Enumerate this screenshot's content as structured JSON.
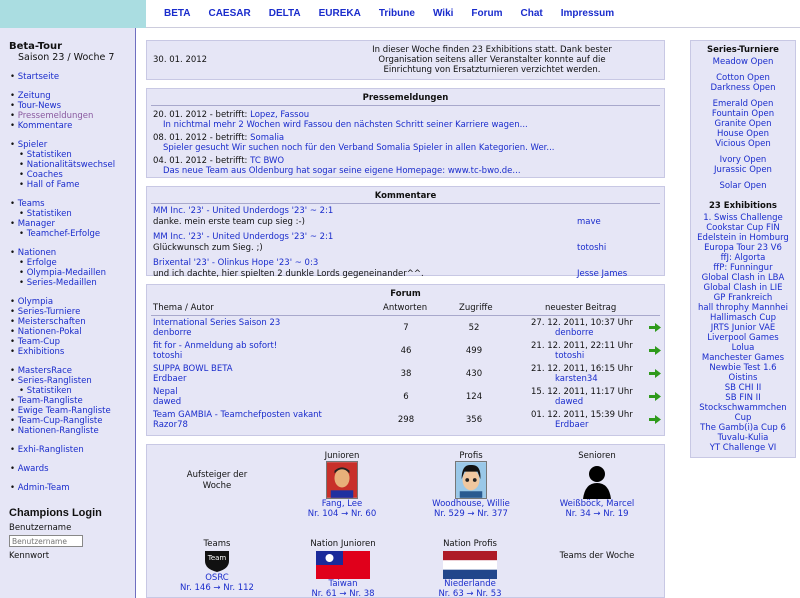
{
  "nav": [
    "BETA",
    "CAESAR",
    "DELTA",
    "EUREKA",
    "Tribune",
    "Wiki",
    "Forum",
    "Chat",
    "Impressum"
  ],
  "sidebar": {
    "title": "Beta-Tour",
    "season": "Saison 23 / Woche 7",
    "groups": [
      [
        {
          "t": "Startseite"
        }
      ],
      [
        {
          "t": "Zeitung"
        },
        {
          "t": "Tour-News"
        },
        {
          "t": "Pressemeldungen",
          "cur": true
        },
        {
          "t": "Kommentare"
        }
      ],
      [
        {
          "t": "Spieler"
        },
        {
          "t": "Statistiken",
          "sub": true
        },
        {
          "t": "Nationalitätswechsel",
          "sub": true
        },
        {
          "t": "Coaches",
          "sub": true
        },
        {
          "t": "Hall of Fame",
          "sub": true
        }
      ],
      [
        {
          "t": "Teams"
        },
        {
          "t": "Statistiken",
          "sub": true
        },
        {
          "t": "Manager"
        },
        {
          "t": "Teamchef-Erfolge",
          "sub": true
        }
      ],
      [
        {
          "t": "Nationen"
        },
        {
          "t": "Erfolge",
          "sub": true
        },
        {
          "t": "Olympia-Medaillen",
          "sub": true
        },
        {
          "t": "Series-Medaillen",
          "sub": true
        }
      ],
      [
        {
          "t": "Olympia"
        },
        {
          "t": "Series-Turniere"
        },
        {
          "t": "Meisterschaften"
        },
        {
          "t": "Nationen-Pokal"
        },
        {
          "t": "Team-Cup"
        },
        {
          "t": "Exhibitions"
        }
      ],
      [
        {
          "t": "MastersRace"
        },
        {
          "t": "Series-Ranglisten"
        },
        {
          "t": "Statistiken",
          "sub": true
        },
        {
          "t": "Team-Rangliste"
        },
        {
          "t": "Ewige Team-Rangliste"
        },
        {
          "t": "Team-Cup-Rangliste"
        },
        {
          "t": "Nationen-Rangliste"
        }
      ],
      [
        {
          "t": "Exhi-Ranglisten"
        }
      ],
      [
        {
          "t": "Awards"
        }
      ],
      [
        {
          "t": "Admin-Team"
        }
      ]
    ]
  },
  "login": {
    "title": "Champions Login",
    "user_label": "Benutzername",
    "user_placeholder": "Benutzername",
    "pass_label": "Kennwort"
  },
  "news": {
    "date": "30. 01. 2012",
    "text": "In dieser Woche finden 23 Exhibitions statt. Dank bester Organisation seitens aller Veranstalter konnte auf die Einrichtung von Ersatzturnieren verzichtet werden."
  },
  "press": {
    "title": "Pressemeldungen",
    "items": [
      {
        "date": "20. 01. 2012",
        "by": " - betrifft: ",
        "who": "Lopez, Fassou",
        "text": "In nichtmal mehr 2 Wochen wird Fassou den nächsten Schritt seiner Karriere wagen..."
      },
      {
        "date": "08. 01. 2012",
        "by": " - betrifft: ",
        "who": "Somalia",
        "text": "Spieler gesucht Wir suchen noch für den Verband Somalia Spieler in allen Kategorien. Wer..."
      },
      {
        "date": "04. 01. 2012",
        "by": " - betrifft: ",
        "who": "TC BWO",
        "text": "Das neue Team aus Oldenburg hat sogar seine eigene Homepage: www.tc-bwo.de..."
      }
    ]
  },
  "comments": {
    "title": "Kommentare",
    "items": [
      {
        "match": "MM Inc. '23' - United Underdogs '23'   ~   2:1",
        "text": "danke. mein erste team cup sieg :-)",
        "author": "mave"
      },
      {
        "match": "MM Inc. '23' - United Underdogs '23'   ~   2:1",
        "text": "Glückwunsch zum Sieg. ;)",
        "author": "totoshi"
      },
      {
        "match": "Brixental '23' - Olinkus Hope '23'   ~   0:3",
        "text": "und ich dachte, hier spielten 2 dunkle Lords gegeneinander^^.",
        "author": "Jesse James"
      }
    ]
  },
  "forum": {
    "title": "Forum",
    "headers": {
      "topic": "Thema / Autor",
      "replies": "Antworten",
      "views": "Zugriffe",
      "latest": "neuester Beitrag"
    },
    "rows": [
      {
        "topic": "International Series Saison 23",
        "author": "denborre",
        "replies": "7",
        "views": "52",
        "date": "27. 12. 2011, 10:37 Uhr",
        "last": "denborre"
      },
      {
        "topic": "fit for - Anmeldung ab sofort!",
        "author": "totoshi",
        "replies": "46",
        "views": "499",
        "date": "21. 12. 2011, 22:11 Uhr",
        "last": "totoshi"
      },
      {
        "topic": "SUPPA BOWL BETA",
        "author": "Erdbaer",
        "replies": "38",
        "views": "430",
        "date": "21. 12. 2011, 16:15 Uhr",
        "last": "karsten34"
      },
      {
        "topic": "Nepal",
        "author": "dawed",
        "replies": "6",
        "views": "124",
        "date": "15. 12. 2011, 11:17 Uhr",
        "last": "dawed"
      },
      {
        "topic": "Team GAMBIA - Teamchefposten vakant",
        "author": "Razor78",
        "replies": "298",
        "views": "356",
        "date": "01. 12. 2011, 15:39 Uhr",
        "last": "Erdbaer"
      }
    ]
  },
  "week": {
    "aufsteiger": "Aufsteiger der Woche",
    "teams_der_woche": "Teams der Woche",
    "cats": [
      {
        "cat": "Junioren",
        "name": "Fang, Lee",
        "rank": "Nr. 104 → Nr. 60"
      },
      {
        "cat": "Profis",
        "name": "Woodhouse, Willie",
        "rank": "Nr. 529 → Nr. 377"
      },
      {
        "cat": "Senioren",
        "name": "Weißböck, Marcel",
        "rank": "Nr. 34 → Nr. 19"
      },
      {
        "cat": "Teams",
        "name": "OSRC",
        "rank": "Nr. 146 → Nr. 112"
      },
      {
        "cat": "Nation Junioren",
        "name": "Taiwan",
        "rank": "Nr. 61 → Nr. 38"
      },
      {
        "cat": "Nation Profis",
        "name": "Niederlande",
        "rank": "Nr. 63 → Nr. 53"
      }
    ],
    "team_logo_text": "Team"
  },
  "right": {
    "series_title": "Series-Turniere",
    "series": [
      [
        "Meadow Open"
      ],
      [
        "Cotton Open",
        "Darkness Open"
      ],
      [
        "Emerald Open",
        "Fountain Open",
        "Granite Open",
        "House Open",
        "Vicious Open"
      ],
      [
        "Ivory Open",
        "Jurassic Open"
      ],
      [
        "Solar Open"
      ]
    ],
    "exhi_title": "23 Exhibitions",
    "exhi": [
      "1. Swiss Challenge",
      "Cookstar Cup FIN",
      "Edelstein in Homburg",
      "Europa Tour 23 V6",
      "ffJ: Algorta",
      "ffP: Funningur",
      "Global Clash in LBA",
      "Global Clash in LIE",
      "GP Frankreich",
      "hall throphy Mannhei",
      "Hallimasch Cup",
      "JRTS Junior VAE",
      "Liverpool Games",
      "Lolua",
      "Manchester Games",
      "Newbie Test 1.6",
      "Oistins",
      "SB CHI II",
      "SB FIN II",
      "Stockschwammchen Cup",
      "The Gamb(i)a Cup 6",
      "Tuvalu-Kulia",
      "YT Challenge VI"
    ]
  },
  "colors": {
    "link": "#1a2ccc",
    "panel": "#e6e6f6",
    "topcorner": "#aadde1",
    "arrow": "#2f9a1c"
  }
}
